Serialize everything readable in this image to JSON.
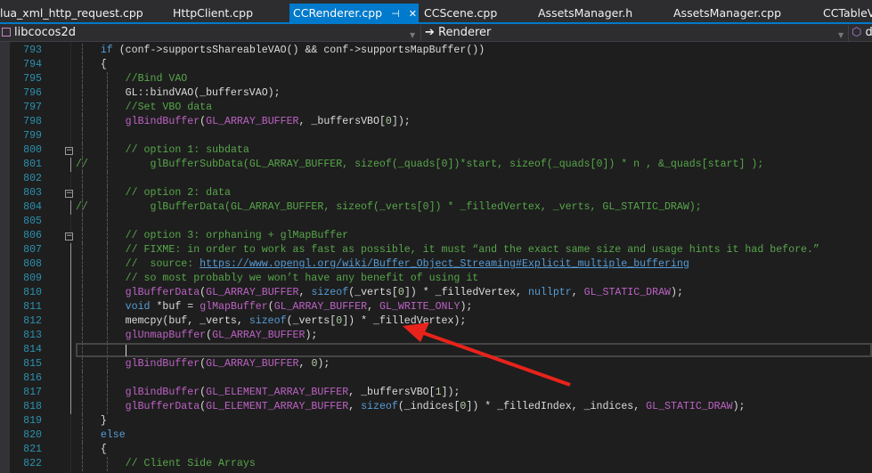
{
  "tabs": [
    {
      "label": "lua_xml_http_request.cpp",
      "active": false
    },
    {
      "label": "HttpClient.cpp",
      "active": false
    },
    {
      "label": "CCRenderer.cpp",
      "active": true
    },
    {
      "label": "CCScene.cpp",
      "active": false
    },
    {
      "label": "AssetsManager.h",
      "active": false
    },
    {
      "label": "AssetsManager.cpp",
      "active": false
    },
    {
      "label": "CCTableV",
      "active": false
    }
  ],
  "navbar": {
    "project": "libcocos2d",
    "scope": "Renderer",
    "member": "d"
  },
  "editor": {
    "current_line": 814,
    "lines": [
      {
        "n": 793,
        "t": [
          [
            "    "
          ],
          [
            "if",
            "kw"
          ],
          [
            " (conf->supportsShareableVAO() && conf->supportsMapBuffer())"
          ]
        ]
      },
      {
        "n": 794,
        "t": [
          [
            "    {"
          ]
        ]
      },
      {
        "n": 795,
        "t": [
          [
            "        "
          ],
          [
            "//Bind VAO",
            "cm"
          ]
        ]
      },
      {
        "n": 796,
        "t": [
          [
            "        GL::bindVAO(_buffersVAO);"
          ]
        ]
      },
      {
        "n": 797,
        "t": [
          [
            "        "
          ],
          [
            "//Set VBO data",
            "cm"
          ]
        ]
      },
      {
        "n": 798,
        "t": [
          [
            "        "
          ],
          [
            "glBindBuffer",
            "fn"
          ],
          [
            "("
          ],
          [
            "GL_ARRAY_BUFFER",
            "mc"
          ],
          [
            ", _buffersVBO["
          ],
          [
            "0",
            "num"
          ],
          [
            "]);"
          ]
        ]
      },
      {
        "n": 799,
        "t": [
          [
            ""
          ]
        ]
      },
      {
        "n": 800,
        "fold": true,
        "t": [
          [
            "        "
          ],
          [
            "// option 1: subdata",
            "cm"
          ]
        ]
      },
      {
        "n": 801,
        "t": [
          [
            "//",
            "cm"
          ],
          [
            "        "
          ],
          [
            "  glBufferSubData(GL_ARRAY_BUFFER, sizeof(_quads[0])*start, sizeof(_quads[0]) * n , &_quads[start] );",
            "cm"
          ]
        ]
      },
      {
        "n": 802,
        "t": [
          [
            ""
          ]
        ]
      },
      {
        "n": 803,
        "fold": true,
        "t": [
          [
            "        "
          ],
          [
            "// option 2: data",
            "cm"
          ]
        ]
      },
      {
        "n": 804,
        "t": [
          [
            "//",
            "cm"
          ],
          [
            "        "
          ],
          [
            "  glBufferData(GL_ARRAY_BUFFER, sizeof(_verts[0]) * _filledVertex, _verts, GL_STATIC_DRAW);",
            "cm"
          ]
        ]
      },
      {
        "n": 805,
        "t": [
          [
            ""
          ]
        ]
      },
      {
        "n": 806,
        "fold": true,
        "t": [
          [
            "        "
          ],
          [
            "// option 3: orphaning + glMapBuffer",
            "cm"
          ]
        ]
      },
      {
        "n": 807,
        "t": [
          [
            "        "
          ],
          [
            "// FIXME: in order to work as fast as possible, it must “and the exact same size and usage hints it had before.”",
            "cm"
          ]
        ]
      },
      {
        "n": 808,
        "t": [
          [
            "        "
          ],
          [
            "//  source: ",
            "cm"
          ],
          [
            "https://www.opengl.org/wiki/Buffer_Object_Streaming#Explicit_multiple_buffering",
            "lk"
          ]
        ]
      },
      {
        "n": 809,
        "t": [
          [
            "        "
          ],
          [
            "// so most probably we won’t have any benefit of using it",
            "cm"
          ]
        ]
      },
      {
        "n": 810,
        "t": [
          [
            "        "
          ],
          [
            "glBufferData",
            "fn"
          ],
          [
            "("
          ],
          [
            "GL_ARRAY_BUFFER",
            "mc"
          ],
          [
            ", "
          ],
          [
            "sizeof",
            "kw"
          ],
          [
            "(_verts["
          ],
          [
            "0",
            "num"
          ],
          [
            "]) * _filledVertex, "
          ],
          [
            "nullptr",
            "kw"
          ],
          [
            ", "
          ],
          [
            "GL_STATIC_DRAW",
            "mc"
          ],
          [
            ");"
          ]
        ]
      },
      {
        "n": 811,
        "t": [
          [
            "        "
          ],
          [
            "void",
            "kw"
          ],
          [
            " *buf = "
          ],
          [
            "glMapBuffer",
            "fn"
          ],
          [
            "("
          ],
          [
            "GL_ARRAY_BUFFER",
            "mc"
          ],
          [
            ", "
          ],
          [
            "GL_WRITE_ONLY",
            "mc"
          ],
          [
            ");"
          ]
        ]
      },
      {
        "n": 812,
        "t": [
          [
            "        memcpy(buf, _verts, "
          ],
          [
            "sizeof",
            "kw"
          ],
          [
            "(_verts["
          ],
          [
            "0",
            "num"
          ],
          [
            "]) * _filledVertex);"
          ]
        ]
      },
      {
        "n": 813,
        "t": [
          [
            "        "
          ],
          [
            "glUnmapBuffer",
            "fn"
          ],
          [
            "("
          ],
          [
            "GL_ARRAY_BUFFER",
            "mc"
          ],
          [
            ");"
          ]
        ]
      },
      {
        "n": 814,
        "t": [
          [
            ""
          ]
        ]
      },
      {
        "n": 815,
        "t": [
          [
            "        "
          ],
          [
            "glBindBuffer",
            "fn"
          ],
          [
            "("
          ],
          [
            "GL_ARRAY_BUFFER",
            "mc"
          ],
          [
            ", "
          ],
          [
            "0",
            "num"
          ],
          [
            ");"
          ]
        ]
      },
      {
        "n": 816,
        "t": [
          [
            ""
          ]
        ]
      },
      {
        "n": 817,
        "t": [
          [
            "        "
          ],
          [
            "glBindBuffer",
            "fn"
          ],
          [
            "("
          ],
          [
            "GL_ELEMENT_ARRAY_BUFFER",
            "mc"
          ],
          [
            ", _buffersVBO["
          ],
          [
            "1",
            "num"
          ],
          [
            "]);"
          ]
        ]
      },
      {
        "n": 818,
        "t": [
          [
            "        "
          ],
          [
            "glBufferData",
            "fn"
          ],
          [
            "("
          ],
          [
            "GL_ELEMENT_ARRAY_BUFFER",
            "mc"
          ],
          [
            ", "
          ],
          [
            "sizeof",
            "kw"
          ],
          [
            "(_indices["
          ],
          [
            "0",
            "num"
          ],
          [
            "]) * _filledIndex, _indices, "
          ],
          [
            "GL_STATIC_DRAW",
            "mc"
          ],
          [
            ");"
          ]
        ]
      },
      {
        "n": 819,
        "t": [
          [
            "    }"
          ]
        ]
      },
      {
        "n": 820,
        "t": [
          [
            "    "
          ],
          [
            "else",
            "kw"
          ]
        ]
      },
      {
        "n": 821,
        "t": [
          [
            "    {"
          ]
        ]
      },
      {
        "n": 822,
        "t": [
          [
            "        "
          ],
          [
            "// Client Side Arrays",
            "cm"
          ]
        ]
      }
    ]
  },
  "colors": {
    "accent": "#007acc",
    "arrow": "#e8231b"
  }
}
